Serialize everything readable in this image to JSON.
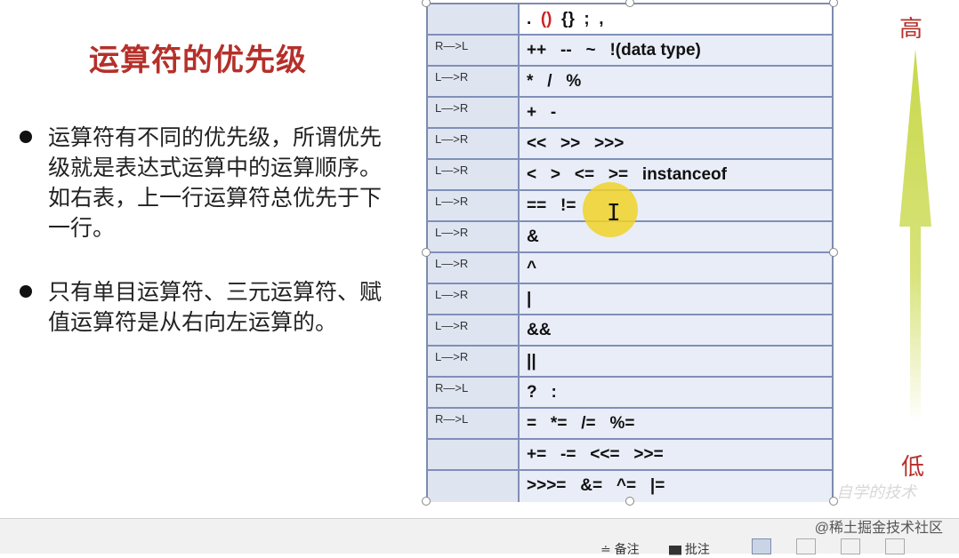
{
  "slide": {
    "title": "运算符的优先级",
    "bullets": [
      "运算符有不同的优先级，所谓优先级就是表达式运算中的运算顺序。如右表，上一行运算符总优先于下一行。",
      "只有单目运算符、三元运算符、赋值运算符是从右向左运算的。"
    ],
    "table": {
      "rows": [
        {
          "assoc": "",
          "ops": ".  ()  {}  ;  ,"
        },
        {
          "assoc": "R—>L",
          "ops": "++   --   ~   !(data type)"
        },
        {
          "assoc": "L—>R",
          "ops": "*   /   %"
        },
        {
          "assoc": "L—>R",
          "ops": "+   -"
        },
        {
          "assoc": "L—>R",
          "ops": "<<   >>   >>>"
        },
        {
          "assoc": "L—>R",
          "ops": "<   >   <=   >=   instanceof"
        },
        {
          "assoc": "L—>R",
          "ops": "==   !="
        },
        {
          "assoc": "L—>R",
          "ops": "&"
        },
        {
          "assoc": "L—>R",
          "ops": "^"
        },
        {
          "assoc": "L—>R",
          "ops": "|"
        },
        {
          "assoc": "L—>R",
          "ops": "&&"
        },
        {
          "assoc": "L—>R",
          "ops": "||"
        },
        {
          "assoc": "R—>L",
          "ops": "?   :"
        },
        {
          "assoc": "R—>L",
          "ops": "=   *=   /=   %="
        },
        {
          "assoc": "",
          "ops": "+=   -=   <<=   >>="
        },
        {
          "assoc": "",
          "ops": ">>>=   &=   ^=   |="
        }
      ]
    },
    "arrow": {
      "high_label": "高",
      "low_label": "低",
      "color": "#c8d84a"
    },
    "watermark": "自学的技术"
  },
  "statusbar": {
    "credit": "@稀土掘金技术社区",
    "notes_label": "≐ 备注",
    "comments_label": "▆ 批注"
  },
  "colors": {
    "title": "#b5302a",
    "table_fill": "#e9edf7",
    "table_border": "#7f8fb8",
    "cursor_highlight": "#f0d228"
  }
}
